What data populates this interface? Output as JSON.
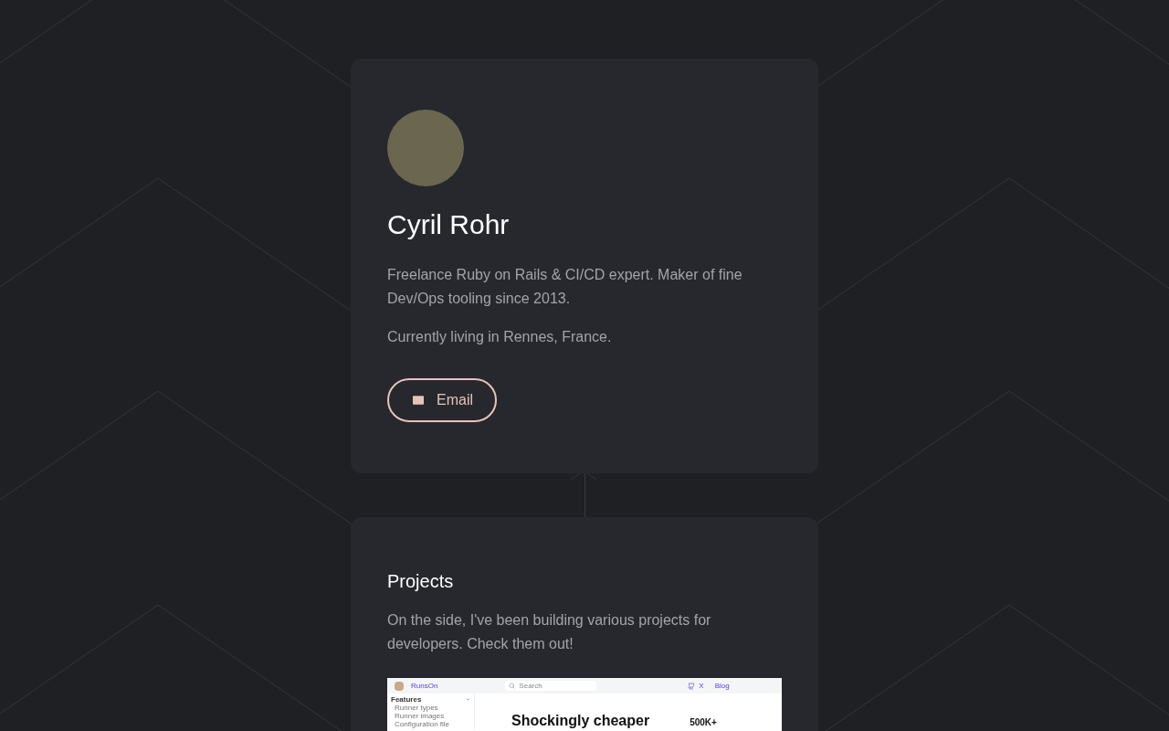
{
  "profile": {
    "name": "Cyril Rohr",
    "paragraphs": [
      "Freelance Ruby on Rails & CI/CD expert. Maker of fine Dev/Ops tooling since 2013.",
      "Currently living in Rennes, France."
    ],
    "email_button": "Email"
  },
  "projects": {
    "title": "Projects",
    "intro": "On the side, I've been building various projects for developers. Check them out!",
    "preview": {
      "brand": "RunsOn",
      "search_placeholder": "Search",
      "nav_links": [
        "X",
        "Blog"
      ],
      "sidebar_heading": "Features",
      "sidebar_items": [
        "Runner types",
        "Runner images",
        "Configuration file"
      ],
      "headline": "Shockingly cheaper",
      "stat": "500K+"
    }
  }
}
